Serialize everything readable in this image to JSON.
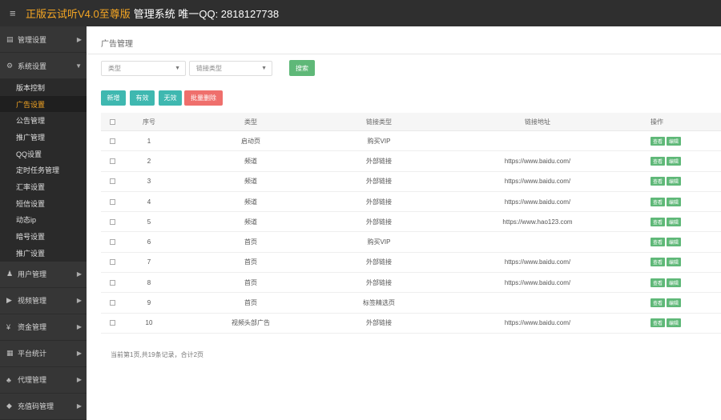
{
  "header": {
    "brand": "正版云试听V4.0至尊版",
    "system": "管理系统 唯一QQ: 2818127738"
  },
  "sidebar": {
    "sections_top": [
      {
        "label": "管理设置",
        "icon": "book-icon",
        "glyph": "▤"
      },
      {
        "label": "系统设置",
        "icon": "cogs-icon",
        "glyph": "⚙"
      }
    ],
    "sub_items": [
      {
        "label": "版本控制",
        "active": false
      },
      {
        "label": "广告设置",
        "active": true
      },
      {
        "label": "公告管理",
        "active": false
      },
      {
        "label": "推广管理",
        "active": false
      },
      {
        "label": "QQ设置",
        "active": false
      },
      {
        "label": "定时任务管理",
        "active": false
      },
      {
        "label": "汇率设置",
        "active": false
      },
      {
        "label": "短信设置",
        "active": false
      },
      {
        "label": "动态ip",
        "active": false
      },
      {
        "label": "暗号设置",
        "active": false
      },
      {
        "label": "推广设置",
        "active": false
      }
    ],
    "sections_bottom": [
      {
        "label": "用户管理",
        "icon": "user-icon",
        "glyph": "♟"
      },
      {
        "label": "视频管理",
        "icon": "video-icon",
        "glyph": "▶"
      },
      {
        "label": "资金管理",
        "icon": "yen-icon",
        "glyph": "¥"
      },
      {
        "label": "平台统计",
        "icon": "chart-icon",
        "glyph": "▦"
      },
      {
        "label": "代理管理",
        "icon": "group-icon",
        "glyph": "♣"
      },
      {
        "label": "充值码管理",
        "icon": "diamond-icon",
        "glyph": "◆"
      }
    ]
  },
  "main": {
    "breadcrumb": "广告管理",
    "filters": {
      "type_placeholder": "类型",
      "link_type_placeholder": "链接类型",
      "search_label": "搜索"
    },
    "actions": {
      "add": "新增",
      "enable": "有效",
      "disable": "无效",
      "batch_delete": "批量删除"
    },
    "table": {
      "headers": {
        "id": "序号",
        "type": "类型",
        "link_type": "链接类型",
        "link_url": "链接地址",
        "ops": "操作"
      },
      "rows": [
        {
          "id": "1",
          "type": "启动页",
          "link_type": "购买VIP",
          "url": ""
        },
        {
          "id": "2",
          "type": "频道",
          "link_type": "外部链接",
          "url": "https://www.baidu.com/"
        },
        {
          "id": "3",
          "type": "频道",
          "link_type": "外部链接",
          "url": "https://www.baidu.com/"
        },
        {
          "id": "4",
          "type": "频道",
          "link_type": "外部链接",
          "url": "https://www.baidu.com/"
        },
        {
          "id": "5",
          "type": "频道",
          "link_type": "外部链接",
          "url": "https://www.hao123.com"
        },
        {
          "id": "6",
          "type": "首页",
          "link_type": "购买VIP",
          "url": ""
        },
        {
          "id": "7",
          "type": "首页",
          "link_type": "外部链接",
          "url": "https://www.baidu.com/"
        },
        {
          "id": "8",
          "type": "首页",
          "link_type": "外部链接",
          "url": "https://www.baidu.com/"
        },
        {
          "id": "9",
          "type": "首页",
          "link_type": "标签精选页",
          "url": ""
        },
        {
          "id": "10",
          "type": "视频头部广告",
          "link_type": "外部链接",
          "url": "https://www.baidu.com/"
        }
      ],
      "op_labels": {
        "view": "查看",
        "edit": "编辑"
      }
    },
    "pagination_info": "当前第1页,共19条记录，合计2页"
  },
  "colors": {
    "topbar": "#2f2f2f",
    "brand": "#f5a623",
    "sidebar": "#363636",
    "green": "#5fb878",
    "teal": "#3fb8b0",
    "red": "#ef6f6c"
  }
}
